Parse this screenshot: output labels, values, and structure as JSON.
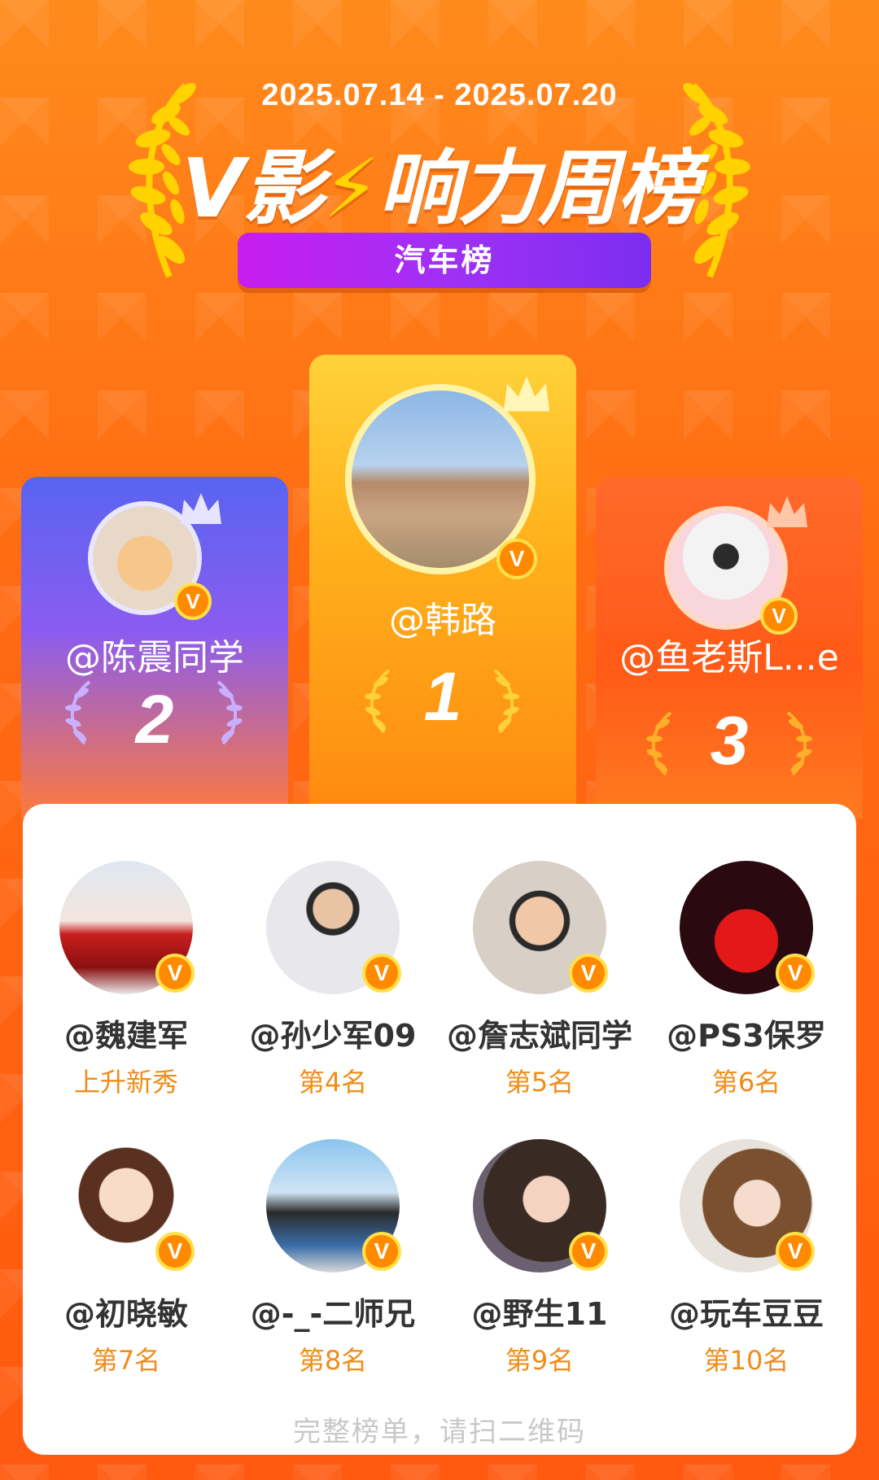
{
  "header": {
    "date_range": "2025.07.14 - 2025.07.20",
    "title_prefix": "V影",
    "title_suffix": "响力周榜",
    "category": "汽车榜"
  },
  "podium": [
    {
      "rank": "1",
      "name": "@韩路"
    },
    {
      "rank": "2",
      "name": "@陈震同学"
    },
    {
      "rank": "3",
      "name": "@鱼老斯L...e"
    }
  ],
  "list": [
    {
      "name": "@魏建军",
      "rank": "上升新秀"
    },
    {
      "name": "@孙少军09",
      "rank": "第4名"
    },
    {
      "name": "@詹志斌同学",
      "rank": "第5名"
    },
    {
      "name": "@PS3保罗",
      "rank": "第6名"
    },
    {
      "name": "@初晓敏",
      "rank": "第7名"
    },
    {
      "name": "@-_-二师兄",
      "rank": "第8名"
    },
    {
      "name": "@野生11",
      "rank": "第9名"
    },
    {
      "name": "@玩车豆豆",
      "rank": "第10名"
    }
  ],
  "verified_badge": "V",
  "footer_hint": "完整榜单，请扫二维码",
  "colors": {
    "accent_orange": "#ff6a12",
    "pill_purple": "#a030f4",
    "rank_text": "#f08c1a",
    "badge": "#ff8a00"
  },
  "icons": [
    "laurel-icon",
    "crown-icon",
    "verified-badge-icon",
    "bolt-icon"
  ]
}
